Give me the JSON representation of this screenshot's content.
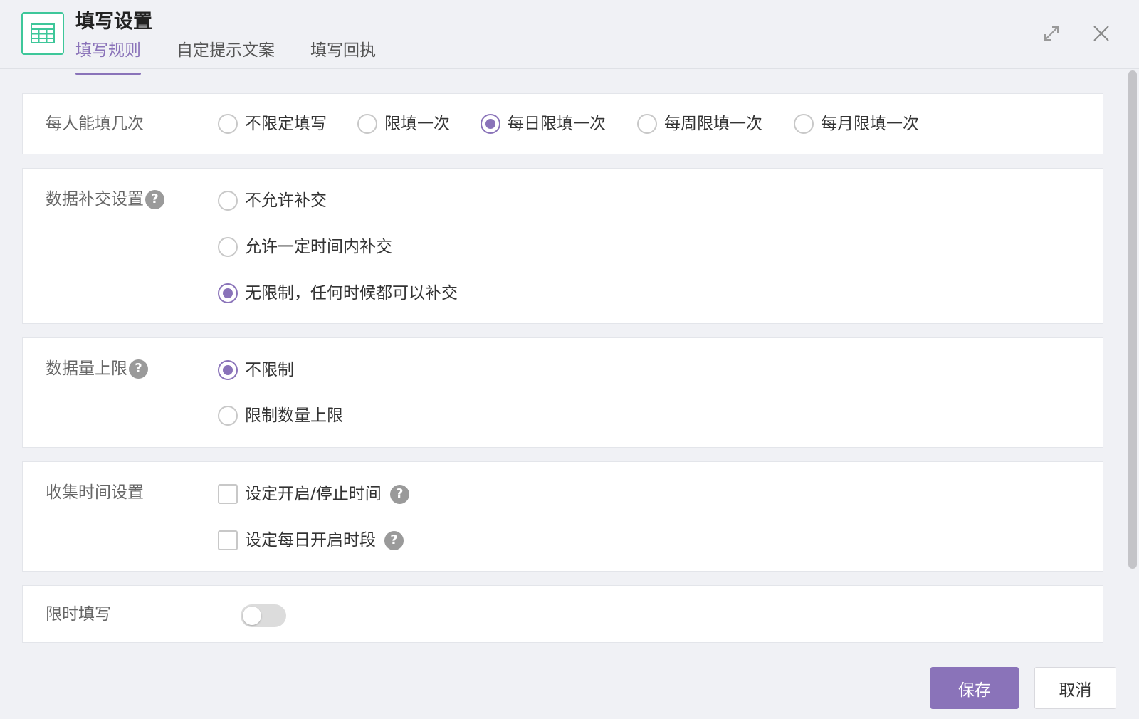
{
  "header": {
    "title": "填写设置",
    "app_icon": "table-icon",
    "tabs": [
      {
        "label": "填写规则",
        "active": true
      },
      {
        "label": "自定提示文案",
        "active": false
      },
      {
        "label": "填写回执",
        "active": false
      }
    ],
    "expand_icon": "expand-icon",
    "close_icon": "close-icon"
  },
  "sections": {
    "fill_count": {
      "label": "每人能填几次",
      "options": [
        "不限定填写",
        "限填一次",
        "每日限填一次",
        "每周限填一次",
        "每月限填一次"
      ],
      "selected": 2
    },
    "resubmit": {
      "label": "数据补交设置",
      "help": "?",
      "options": [
        "不允许补交",
        "允许一定时间内补交",
        "无限制，任何时候都可以补交"
      ],
      "selected": 2
    },
    "data_limit": {
      "label": "数据量上限",
      "help": "?",
      "options": [
        "不限制",
        "限制数量上限"
      ],
      "selected": 0
    },
    "collect_time": {
      "label": "收集时间设置",
      "options": [
        {
          "label": "设定开启/停止时间",
          "checked": false,
          "help": "?"
        },
        {
          "label": "设定每日开启时段",
          "checked": false,
          "help": "?"
        }
      ]
    },
    "timed_fill": {
      "label": "限时填写",
      "enabled": false
    }
  },
  "footer": {
    "save_label": "保存",
    "cancel_label": "取消"
  },
  "colors": {
    "accent": "#8a73b9",
    "icon_green": "#3ec79a"
  }
}
